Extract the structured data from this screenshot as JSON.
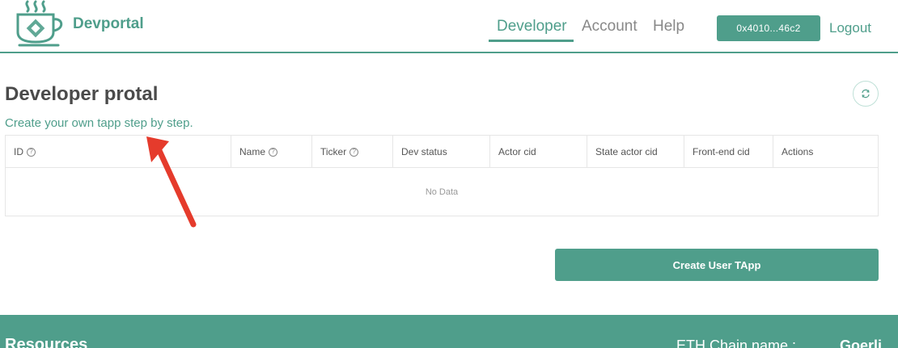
{
  "header": {
    "brand": "Devportal",
    "nav": {
      "developer": "Developer",
      "account": "Account",
      "help": "Help"
    },
    "wallet": "0x4010...46c2",
    "logout": "Logout"
  },
  "main": {
    "title": "Developer protal",
    "subtitle": "Create your own tapp step by step.",
    "table": {
      "columns": [
        "ID",
        "Name",
        "Ticker",
        "Dev status",
        "Actor cid",
        "State actor cid",
        "Front-end cid",
        "Actions"
      ],
      "empty_text": "No Data"
    },
    "create_button": "Create User TApp"
  },
  "footer": {
    "resources": "Resources",
    "chain_label": "ETH Chain name :",
    "chain_value": "Goerli"
  },
  "colors": {
    "accent": "#4f9e8b",
    "arrow": "#e53b2c"
  },
  "icons": [
    "teacup-logo-icon",
    "refresh-icon",
    "question-circle-icon",
    "annotation-arrow-icon"
  ]
}
